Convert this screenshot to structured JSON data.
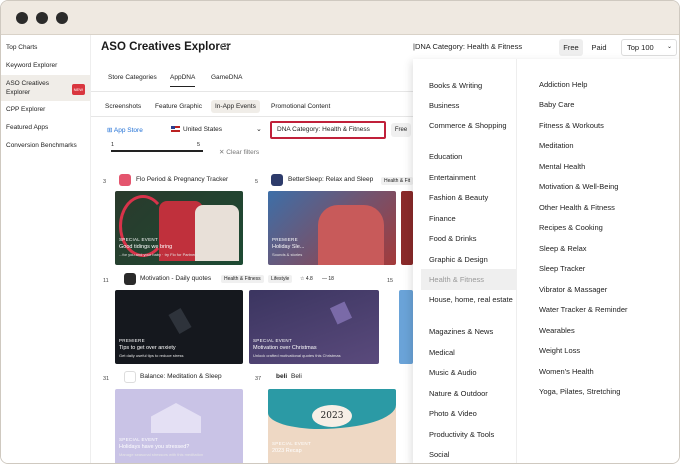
{
  "sidebar": {
    "items": [
      {
        "label": "Top Charts"
      },
      {
        "label": "Keyword Explorer"
      },
      {
        "label": "ASO Creatives Explorer",
        "badge": "NEW"
      },
      {
        "label": "CPP Explorer"
      },
      {
        "label": "Featured Apps"
      },
      {
        "label": "Conversion Benchmarks"
      }
    ]
  },
  "header": {
    "title": "ASO Creatives Explorer",
    "info_icon": "i",
    "filter_label": "DNA Category: Health & Fitness",
    "segments": [
      "Free",
      "Paid"
    ],
    "rank_select": "Top 100"
  },
  "tabs": [
    "Store Categories",
    "AppDNA",
    "GameDNA"
  ],
  "subtabs": [
    "Screenshots",
    "Feature Graphic",
    "In-App Events",
    "Promotional Content"
  ],
  "filters": {
    "store": "App Store",
    "country": "United States",
    "category": "DNA Category: Health & Fitness",
    "free": "Free",
    "paid_partial": "Pa",
    "range_min": "1",
    "range_max": "5",
    "clear": "Clear filters"
  },
  "apps": [
    {
      "rank": "3",
      "name": "Flo Period & Pregnancy Tracker",
      "card_label": "Special event",
      "card_title": "Good tidings we bring",
      "card_sub": "...for you and your baby · try Flo for Partners"
    },
    {
      "rank": "5",
      "name": "BetterSleep: Relax and Sleep",
      "chips": [
        "Health & Fit"
      ],
      "card_label": "Premiere",
      "card_title": "Holiday Sle...",
      "card_sub": "Sounds & stories"
    },
    {
      "rank": "11",
      "name": "Motivation - Daily quotes",
      "chips": [
        "Health & Fitness",
        "Lifestyle",
        "☆ 4.8",
        "— 18"
      ],
      "cards": [
        {
          "label": "Premiere",
          "title": "Tips to get over anxiety",
          "sub": "Get daily useful tips to reduce stress"
        },
        {
          "label": "Special event",
          "title": "Motivation over Christmas",
          "sub": "Unlock crafted motivational quotes this Christmas"
        }
      ]
    },
    {
      "rank": "15"
    },
    {
      "rank": "31",
      "name": "Balance: Meditation & Sleep",
      "card_label": "Special event",
      "card_title": "Holidays have you stressed?",
      "card_sub": "Manage seasonal stressors with this meditation"
    },
    {
      "rank": "37",
      "name": "Beli",
      "card_year": "2023",
      "card_label": "Special event",
      "card_title": "2023 Recap"
    }
  ],
  "categories_col1": [
    "Books & Writing",
    "Business",
    "Commerce & Shopping",
    "Education",
    "Entertainment",
    "Fashion & Beauty",
    "Finance",
    "Food & Drinks",
    "Graphic & Design",
    "Health & Fitness",
    "House, home, real estate",
    "Magazines & News",
    "Medical",
    "Music & Audio",
    "Nature & Outdoor",
    "Photo & Video",
    "Productivity & Tools",
    "Social"
  ],
  "categories_col2": [
    "Addiction Help",
    "Baby Care",
    "Fitness & Workouts",
    "Meditation",
    "Mental Health",
    "Motivation & Well-Being",
    "Other Health & Fitness",
    "Recipes & Cooking",
    "Sleep & Relax",
    "Sleep Tracker",
    "Vibrator & Massager",
    "Water Tracker & Reminder",
    "Wearables",
    "Weight Loss",
    "Women's Health",
    "Yoga, Pilates, Stretching"
  ],
  "selected_category": "Health & Fitness",
  "colors": {
    "accent_border": "#c0203a",
    "badge": "#d9363e",
    "link": "#1f6fd6"
  }
}
